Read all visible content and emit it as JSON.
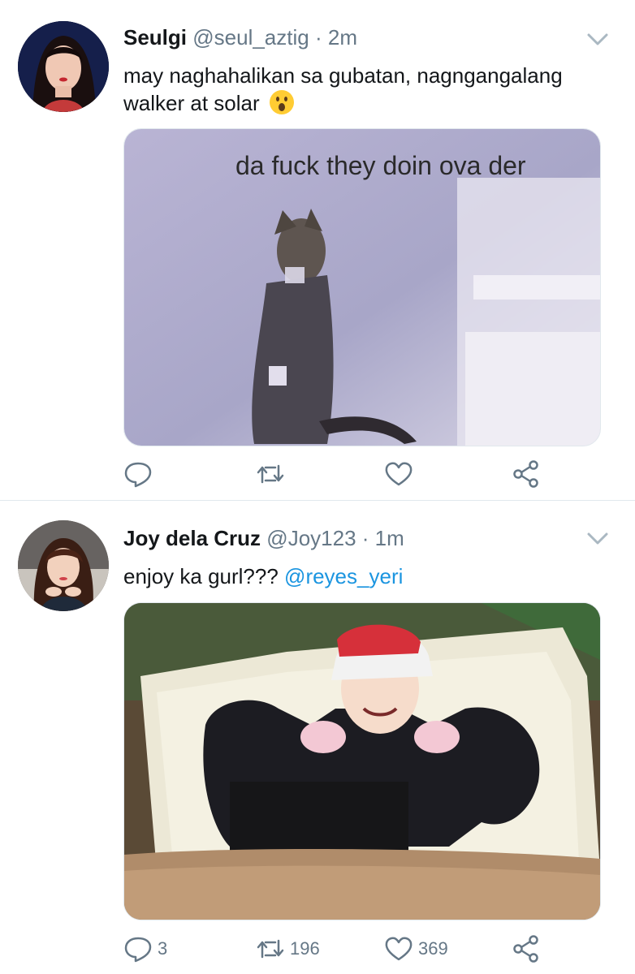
{
  "tweets": [
    {
      "name": "Seulgi",
      "handle": "@seul_aztig",
      "separator": "·",
      "time": "2m",
      "text_line1": "may naghahalikan sa gubatan, nagngangalang",
      "text_line2": "walker at solar",
      "emoji": "surprised-face-emoji",
      "media_caption": "da fuck they doin ova der",
      "actions": {
        "reply_count": "",
        "retweet_count": "",
        "like_count": ""
      }
    },
    {
      "name": "Joy dela Cruz",
      "handle": "@Joy123",
      "separator": "·",
      "time": "1m",
      "text": "enjoy ka gurl???",
      "mention": "@reyes_yeri",
      "actions": {
        "reply_count": "3",
        "retweet_count": "196",
        "like_count": "369"
      }
    }
  ],
  "colors": {
    "text": "#14171a",
    "secondary": "#657786",
    "link": "#1b95e0",
    "divider": "#e1e8ed"
  },
  "icons": [
    "chevron-down-icon",
    "reply-icon",
    "retweet-icon",
    "like-icon",
    "share-icon"
  ]
}
